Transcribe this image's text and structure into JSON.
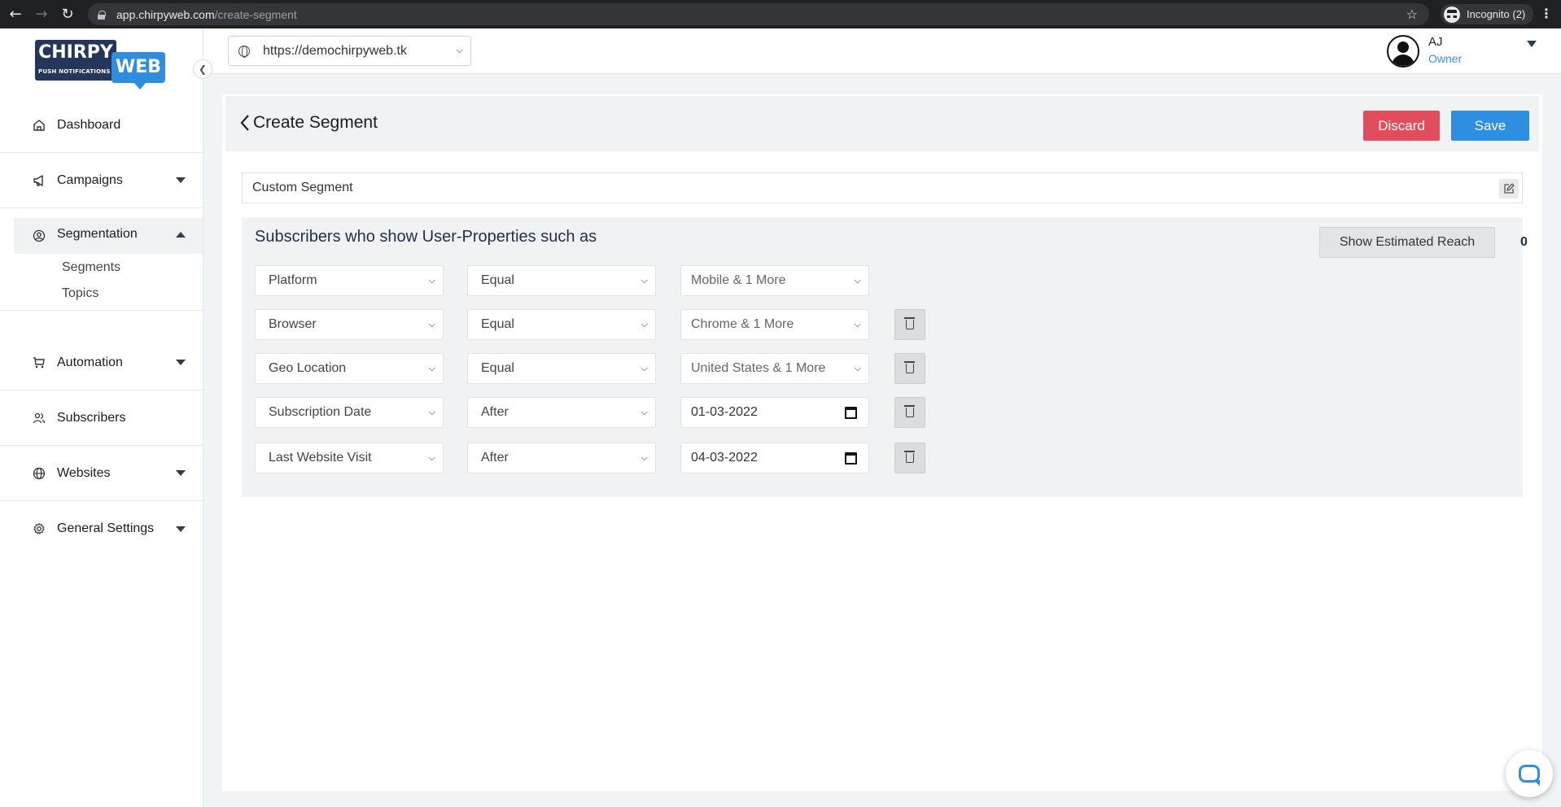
{
  "browser": {
    "url_host": "app.chirpyweb.com",
    "url_path": "/create-segment",
    "incognito_label": "Incognito (2)"
  },
  "brand": {
    "logo_top": "CHIRPY",
    "logo_tagline": "PUSH NOTIFICATIONS",
    "logo_bottom": "WEB",
    "accent_color": "#2e8edf",
    "navy_color": "#24365a"
  },
  "sidebar": {
    "items": [
      {
        "label": "Dashboard",
        "icon": "home-icon"
      },
      {
        "label": "Campaigns",
        "icon": "megaphone-icon"
      },
      {
        "label": "Segmentation",
        "icon": "user-circle-icon"
      },
      {
        "label": "Automation",
        "icon": "cart-icon"
      },
      {
        "label": "Subscribers",
        "icon": "users-icon"
      },
      {
        "label": "Websites",
        "icon": "globe-icon"
      },
      {
        "label": "General Settings",
        "icon": "gear-icon"
      }
    ],
    "sub_items": [
      "Segments",
      "Topics"
    ]
  },
  "header": {
    "site_url": "https://demochirpyweb.tk",
    "user_initials": "AJ",
    "user_role": "Owner"
  },
  "page": {
    "title": "Create Segment",
    "discard_label": "Discard",
    "save_label": "Save",
    "segment_name": "Custom Segment"
  },
  "rules": {
    "heading": "Subscribers who show User-Properties such as",
    "reach_button": "Show Estimated Reach",
    "reach_count": "0",
    "rows": [
      {
        "field": "Platform",
        "operator": "Equal",
        "value": "Mobile & 1 More",
        "value_kind": "select",
        "deletable": false
      },
      {
        "field": "Browser",
        "operator": "Equal",
        "value": "Chrome & 1 More",
        "value_kind": "select",
        "deletable": true
      },
      {
        "field": "Geo Location",
        "operator": "Equal",
        "value": "United States & 1 More",
        "value_kind": "select",
        "deletable": true
      },
      {
        "field": "Subscription Date",
        "operator": "After",
        "value": "01-03-2022",
        "value_kind": "date",
        "deletable": true
      },
      {
        "field": "Last Website Visit",
        "operator": "After",
        "value": "04-03-2022",
        "value_kind": "date",
        "deletable": true
      }
    ]
  },
  "colors": {
    "discard": "#e14d5c",
    "save": "#2e8edf",
    "role_text": "#3b8fd8"
  }
}
